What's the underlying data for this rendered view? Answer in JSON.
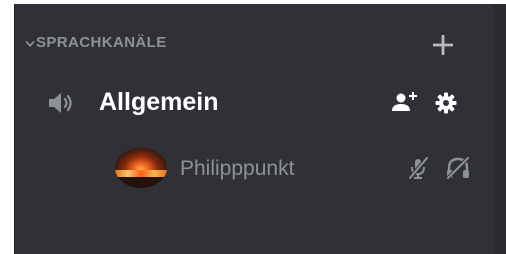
{
  "category": {
    "title": "SPRACHKANÄLE",
    "icons": {
      "collapse": "chevron-down-icon",
      "add": "plus-icon"
    }
  },
  "channel": {
    "name": "Allgemein",
    "icons": {
      "type": "speaker-icon",
      "invite": "invite-user-icon",
      "settings": "gear-icon"
    }
  },
  "voice_user": {
    "username": "Philipppunkt",
    "icons": {
      "muted": "mic-muted-icon",
      "deafened": "headphones-deafened-icon"
    }
  },
  "colors": {
    "panel_bg": "#2f3136",
    "muted_text": "#8e9297",
    "active_text": "#ffffff",
    "icon": "#b9bbbe"
  }
}
